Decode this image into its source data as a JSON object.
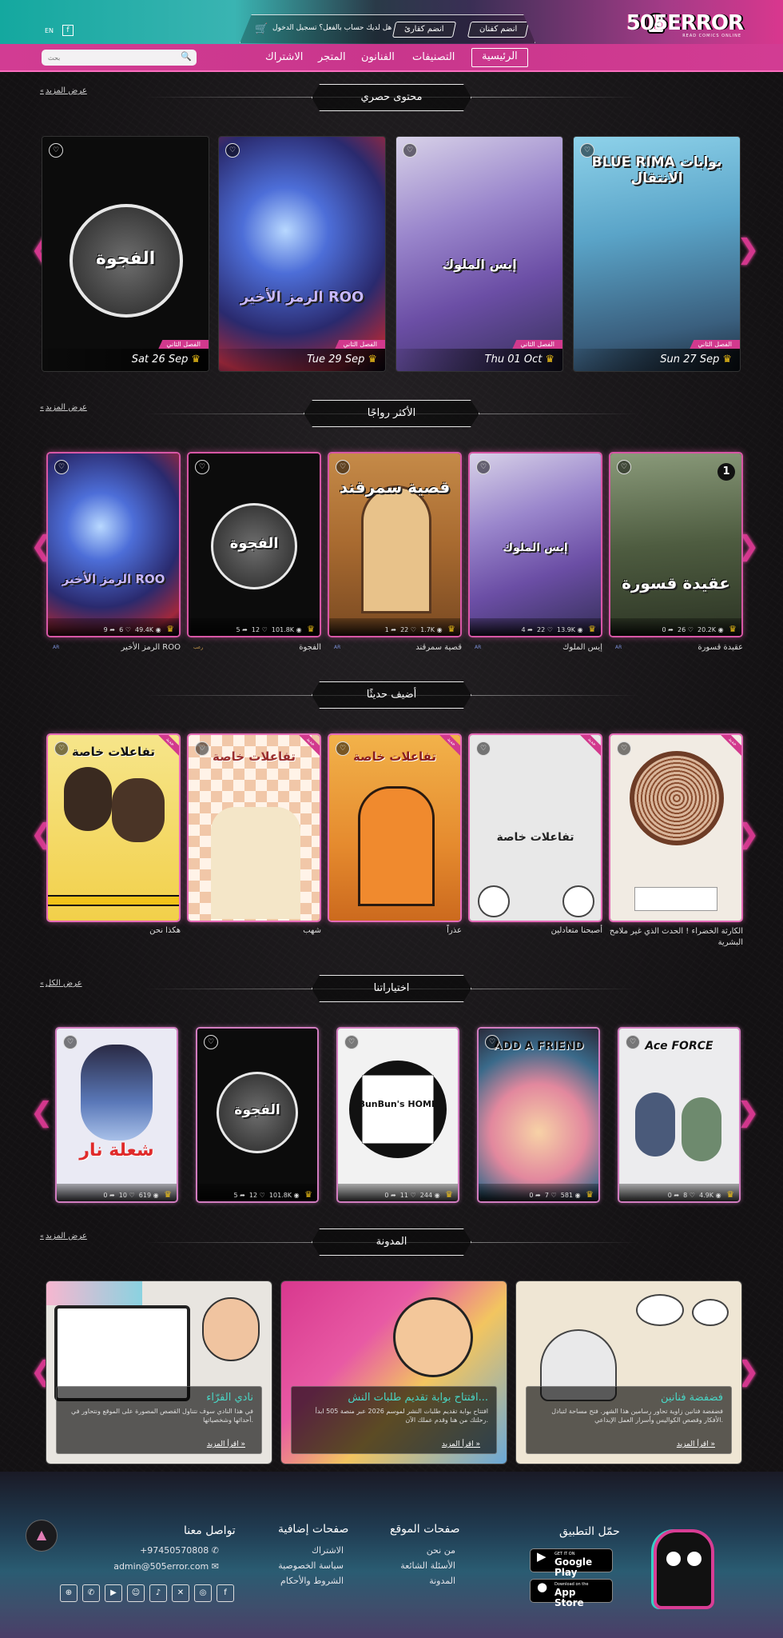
{
  "header": {
    "logo_text": "505ERROR",
    "logo_sub": "READ COMICS ONLINE",
    "join_artist": "انضم كفنان",
    "join_reader": "انضم كقارئ",
    "login_prompt": "هل لديك حساب بالفعل؟ تسجيل الدخول",
    "lang": "EN",
    "fb": "f"
  },
  "nav": {
    "items": [
      "الرئيسية",
      "التصنيفات",
      "الفنانون",
      "المتجر",
      "الاشتراك"
    ],
    "search_placeholder": "بحث"
  },
  "sections": {
    "exclusive": {
      "title": "محتوى حصري",
      "more": "عرض المزيد"
    },
    "popular": {
      "title": "الأكثر رواجًا",
      "more": "عرض المزيد"
    },
    "recent": {
      "title": "أضيف حديثًا"
    },
    "picks": {
      "title": "اختياراتنا",
      "more": "عرض الكل"
    },
    "blog": {
      "title": "المدونة",
      "more": "عرض المزيد"
    }
  },
  "exclusive_cards": [
    {
      "title": "BLUE RIMA بوابات الانتقال",
      "chapter": "الفصل الثاني",
      "date": "Sun 27 Sep",
      "color": "#6db4d4"
    },
    {
      "title": "إيس الملوك",
      "chapter": "الفصل الثاني",
      "date": "Thu 01 Oct",
      "color": "#7a6ab5"
    },
    {
      "title": "الرمز الأخير ROO",
      "chapter": "الفصل الثاني",
      "date": "Tue 29 Sep",
      "color": "#2c3e8e"
    },
    {
      "title": "الفجوة",
      "chapter": "الفصل الثاني",
      "date": "Sat 26 Sep",
      "color": "#1a1a1a"
    }
  ],
  "popular_cards": [
    {
      "title": "عقيدة قسورة",
      "label": "عقيدة قسورة",
      "views": "20.2K",
      "likes": "26",
      "shares": "0",
      "color": "#5a6a48",
      "sub": "AR"
    },
    {
      "title": "إيس الملوك",
      "label": "إيس الملوك",
      "views": "13.9K",
      "likes": "22",
      "shares": "4",
      "color": "#7a6ab5",
      "sub": "AR"
    },
    {
      "title": "قصية سمرقند",
      "label": "قصية سمرقند",
      "views": "1.7K",
      "likes": "22",
      "shares": "1",
      "color": "#b87a3e",
      "sub": "AR"
    },
    {
      "title": "الفجوة",
      "label": "الفجوة",
      "views": "101.8K",
      "likes": "12",
      "shares": "5",
      "color": "#151515",
      "sub": "رعب"
    },
    {
      "title": "الرمز الأخير ROO",
      "label": "الرمز الأخير ROO",
      "views": "49.4K",
      "likes": "6",
      "shares": "9",
      "color": "#2c3e8e",
      "sub": "AR"
    }
  ],
  "recent_cards": [
    {
      "title": "",
      "label": "الكارثة الخضراء ! الحدث الذي غير ملامح البشرية",
      "badge": "جديد",
      "color": "#e9e1d8"
    },
    {
      "title": "تفاعلات خاصة",
      "label": "أصبحنا متعادلين",
      "badge": "جديد",
      "color": "#e4e4e4"
    },
    {
      "title": "تفاعلات خاصة",
      "label": "عذراً",
      "badge": "جديد",
      "color": "#e39a3a"
    },
    {
      "title": "تفاعلات خاصة",
      "label": "شهب",
      "badge": "جديد",
      "color": "#f1dcc6"
    },
    {
      "title": "تفاعلات خاصة",
      "label": "هكذا نحن",
      "badge": "جديد",
      "color": "#f4d95a"
    }
  ],
  "pick_cards": [
    {
      "title": "Ace FORCE",
      "views": "4.9K",
      "likes": "8",
      "shares": "0",
      "color": "#e8e8ea"
    },
    {
      "title": "ADD A FRIEND",
      "views": "581",
      "likes": "7",
      "shares": "0",
      "color": "#e68a9f"
    },
    {
      "title": "BunBun's HOME",
      "views": "244",
      "likes": "11",
      "shares": "0",
      "color": "#f2f2f2"
    },
    {
      "title": "الفجوة",
      "views": "101.8K",
      "likes": "12",
      "shares": "5",
      "color": "#151515"
    },
    {
      "title": "شعلة نار",
      "views": "619",
      "likes": "10",
      "shares": "0",
      "color": "#e9e9f3"
    }
  ],
  "blog_cards": [
    {
      "title": "فضفضة فنانين",
      "text": "فضفضة فنانين زاوية تحاور رسامين هذا الشهر. فتح مساحة لتبادل الأفكار وقصص الكواليس وأسرار العمل الإبداعي.",
      "read": "اقرأ المزيد",
      "color": "#eee4d2"
    },
    {
      "title": "افتتاح بوابة تقديم طلبات النش...",
      "text": "افتتاح بوابة تقديم طلبات النشر لموسم 2026 عبر منصة 505 ابدأ رحلتك من هنا وقدم عملك الآن.",
      "read": "اقرأ المزيد",
      "color": "#c93a8e"
    },
    {
      "title": "نادي القرّاء",
      "text": "في هذا النادي سوف نتناول القصص المصورة على الموقع ونتحاور في أحداثها وشخصياتها.",
      "read": "اقرأ المزيد",
      "color": "#e5e2de"
    }
  ],
  "footer": {
    "app_title": "حمّل التطبيق",
    "google_small": "GET IT ON",
    "google_big": "Google Play",
    "apple_small": "Download on the",
    "apple_big": "App Store",
    "site_pages_title": "صفحات الموقع",
    "site_pages": [
      "من نحن",
      "الأسئلة الشائعة",
      "المدونة"
    ],
    "extra_pages_title": "صفحات إضافية",
    "extra_pages": [
      "الاشتراك",
      "سياسة الخصوصية",
      "الشروط والأحكام"
    ],
    "contact_title": "تواصل معنا",
    "phone": "+97450570808",
    "email": "admin@505error.com"
  }
}
